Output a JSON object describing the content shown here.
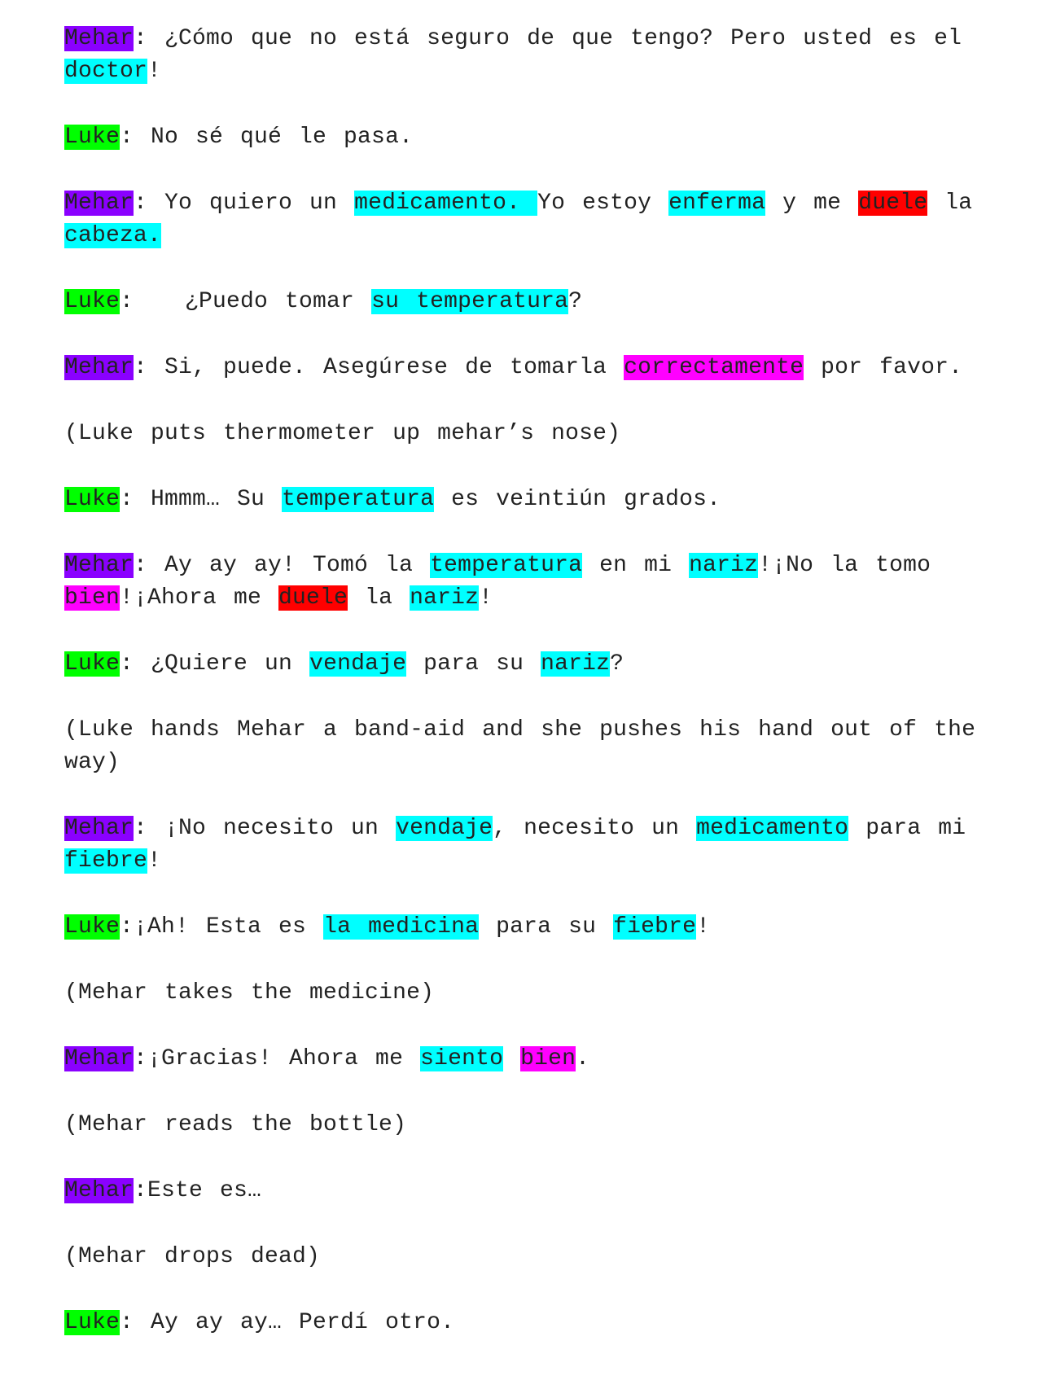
{
  "colors": {
    "cyan": "#00ffff",
    "purple": "#8a00ff",
    "green": "#00ff00",
    "red": "#ff0000",
    "magenta": "#ff00ff"
  },
  "lines": [
    {
      "segments": [
        {
          "text": "Mehar",
          "hl": "purple"
        },
        {
          "text": ": ¿Cómo que no está seguro de que tengo? Pero usted es el "
        },
        {
          "text": "doctor",
          "hl": "cyan"
        },
        {
          "text": "!"
        }
      ]
    },
    {
      "segments": [
        {
          "text": "Luke",
          "hl": "green"
        },
        {
          "text": ": No sé qué le pasa."
        }
      ]
    },
    {
      "segments": [
        {
          "text": "Mehar",
          "hl": "purple"
        },
        {
          "text": ": Yo quiero un "
        },
        {
          "text": "medicamento. ",
          "hl": "cyan"
        },
        {
          "text": "Yo estoy "
        },
        {
          "text": "enferma",
          "hl": "cyan"
        },
        {
          "text": " y me "
        },
        {
          "text": "duele",
          "hl": "red"
        },
        {
          "text": " la "
        },
        {
          "text": "cabeza.",
          "hl": "cyan"
        }
      ]
    },
    {
      "segments": [
        {
          "text": "Luke",
          "hl": "green"
        },
        {
          "text": ":   ¿Puedo tomar "
        },
        {
          "text": "su temperatura",
          "hl": "cyan"
        },
        {
          "text": "?"
        }
      ]
    },
    {
      "segments": [
        {
          "text": "Mehar",
          "hl": "purple"
        },
        {
          "text": ": Si, puede. Asegúrese de tomarla "
        },
        {
          "text": "correctamente",
          "hl": "magenta"
        },
        {
          "text": " por favor."
        }
      ]
    },
    {
      "segments": [
        {
          "text": "(Luke puts thermometer up mehar’s nose)"
        }
      ]
    },
    {
      "segments": [
        {
          "text": "Luke",
          "hl": "green"
        },
        {
          "text": ": Hmmm… Su "
        },
        {
          "text": "temperatura",
          "hl": "cyan"
        },
        {
          "text": " es veintiún grados."
        }
      ]
    },
    {
      "segments": [
        {
          "text": "Mehar",
          "hl": "purple"
        },
        {
          "text": ": Ay ay ay! Tomó la "
        },
        {
          "text": "temperatura",
          "hl": "cyan"
        },
        {
          "text": " en mi "
        },
        {
          "text": "nariz",
          "hl": "cyan"
        },
        {
          "text": "!¡No la tomo "
        },
        {
          "text": "bien",
          "hl": "magenta"
        },
        {
          "text": "!¡Ahora me "
        },
        {
          "text": "duele",
          "hl": "red"
        },
        {
          "text": " la "
        },
        {
          "text": "nariz",
          "hl": "cyan"
        },
        {
          "text": "!"
        }
      ]
    },
    {
      "segments": [
        {
          "text": "Luke",
          "hl": "green"
        },
        {
          "text": ": ¿Quiere un "
        },
        {
          "text": "vendaje",
          "hl": "cyan"
        },
        {
          "text": " para su "
        },
        {
          "text": "nariz",
          "hl": "cyan"
        },
        {
          "text": "?"
        }
      ]
    },
    {
      "segments": [
        {
          "text": "(Luke hands Mehar a band-aid and she pushes his hand out of the way)"
        }
      ]
    },
    {
      "segments": [
        {
          "text": "Mehar",
          "hl": "purple"
        },
        {
          "text": ": ¡No necesito un "
        },
        {
          "text": "vendaje",
          "hl": "cyan"
        },
        {
          "text": ", necesito un "
        },
        {
          "text": "medicamento",
          "hl": "cyan"
        },
        {
          "text": " para mi "
        },
        {
          "text": "fiebre",
          "hl": "cyan"
        },
        {
          "text": "!"
        }
      ]
    },
    {
      "segments": [
        {
          "text": "Luke",
          "hl": "green"
        },
        {
          "text": ":¡Ah! Esta es "
        },
        {
          "text": "la medicina",
          "hl": "cyan"
        },
        {
          "text": " para su "
        },
        {
          "text": "fiebre",
          "hl": "cyan"
        },
        {
          "text": "!"
        }
      ]
    },
    {
      "segments": [
        {
          "text": "(Mehar takes the medicine)"
        }
      ]
    },
    {
      "segments": [
        {
          "text": "Mehar",
          "hl": "purple"
        },
        {
          "text": ":¡Gracias! Ahora me "
        },
        {
          "text": "siento",
          "hl": "cyan"
        },
        {
          "text": " "
        },
        {
          "text": "bien",
          "hl": "magenta"
        },
        {
          "text": "."
        }
      ]
    },
    {
      "segments": [
        {
          "text": "(Mehar reads the bottle)"
        }
      ]
    },
    {
      "segments": [
        {
          "text": "Mehar",
          "hl": "purple"
        },
        {
          "text": ":Este es…"
        }
      ]
    },
    {
      "segments": [
        {
          "text": "(Mehar drops dead)"
        }
      ]
    },
    {
      "segments": [
        {
          "text": "Luke",
          "hl": "green"
        },
        {
          "text": ": Ay ay ay… Perdí otro."
        }
      ]
    }
  ]
}
